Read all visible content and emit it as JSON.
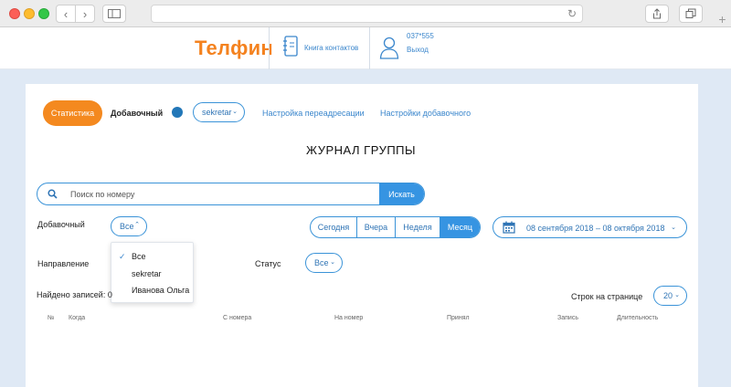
{
  "site": {
    "logo": "Телфин",
    "contacts_label": "Книга контактов",
    "account_number": "037*555",
    "logout_label": "Выход"
  },
  "toolbar": {
    "statistics_label": "Статистика",
    "extension_label": "Добавочный",
    "extension_value": "sekretar",
    "redirect_settings_label": "Настройка переадресации",
    "extension_settings_label": "Настройки добавочного"
  },
  "page_title": "ЖУРНАЛ ГРУППЫ",
  "search": {
    "placeholder": "Поиск по номеру",
    "button_label": "Искать"
  },
  "filters": {
    "extension_label": "Добавочный",
    "extension_value": "Все",
    "direction_label": "Направление",
    "status_label": "Статус",
    "status_value": "Все",
    "period_options": [
      "Сегодня",
      "Вчера",
      "Неделя",
      "Месяц"
    ],
    "period_selected": "Месяц",
    "date_range": "08 сентября 2018 – 08 октября 2018"
  },
  "extension_dropdown": {
    "options": [
      "Все",
      "sekretar",
      "Иванова Ольга"
    ],
    "selected": "Все"
  },
  "results": {
    "found_label": "Найдено записей: 0",
    "rows_per_page_label": "Строк на странице",
    "rows_per_page_value": "20"
  },
  "table": {
    "columns": [
      "№",
      "Когда",
      "С номера",
      "На номер",
      "Принял",
      "Запись",
      "Длительность"
    ]
  },
  "colors": {
    "brand_orange": "#f4821f",
    "accent_blue": "#3694e2",
    "status_dot": "#2277b8"
  }
}
